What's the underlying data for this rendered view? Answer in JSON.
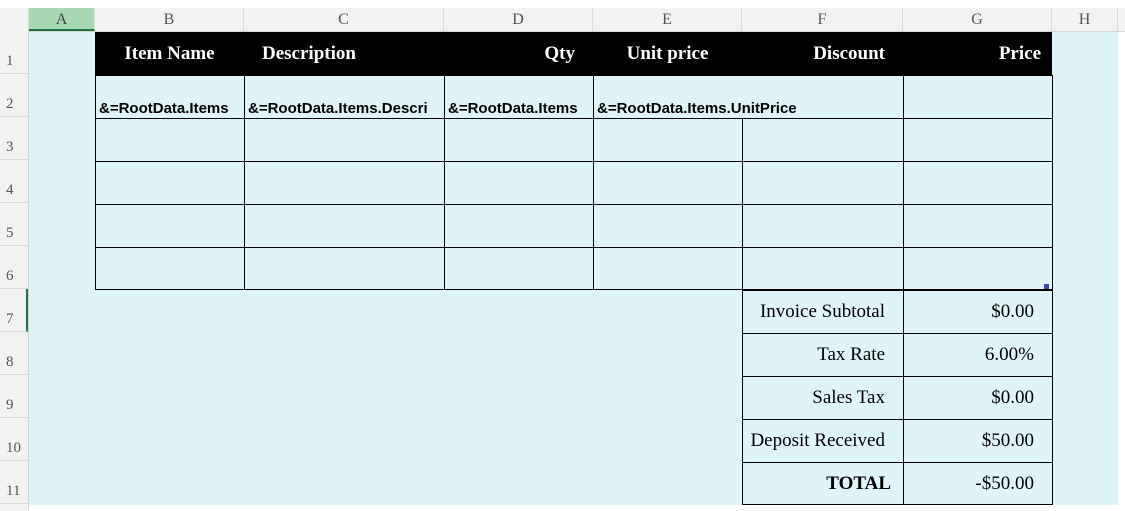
{
  "columns": [
    "A",
    "B",
    "C",
    "D",
    "E",
    "F",
    "G",
    "H"
  ],
  "rows": [
    "1",
    "2",
    "3",
    "4",
    "5",
    "6",
    "7",
    "8",
    "9",
    "10",
    "11"
  ],
  "selected_column": "A",
  "selected_row": "7",
  "table": {
    "headers": {
      "item_name": "Item Name",
      "description": "Description",
      "qty": "Qty",
      "unit_price": "Unit price",
      "discount": "Discount",
      "price": "Price"
    },
    "bindings": {
      "item_name": "&=RootData.Items",
      "description": "&=RootData.Items.Descri",
      "qty": "&=RootData.Items",
      "unit_price": "&=RootData.Items.UnitPrice"
    }
  },
  "summary": [
    {
      "label": "Invoice Subtotal",
      "value": "$0.00"
    },
    {
      "label": "Tax Rate",
      "value": "6.00%"
    },
    {
      "label": "Sales Tax",
      "value": "$0.00"
    },
    {
      "label": "Deposit Received",
      "value": "$50.00"
    },
    {
      "label": "TOTAL",
      "value": "-$50.00"
    }
  ],
  "colors": {
    "sheet_background": "#dff4f8",
    "header_fill": "#000000",
    "header_text": "#ffffff",
    "selection": "#217346"
  }
}
